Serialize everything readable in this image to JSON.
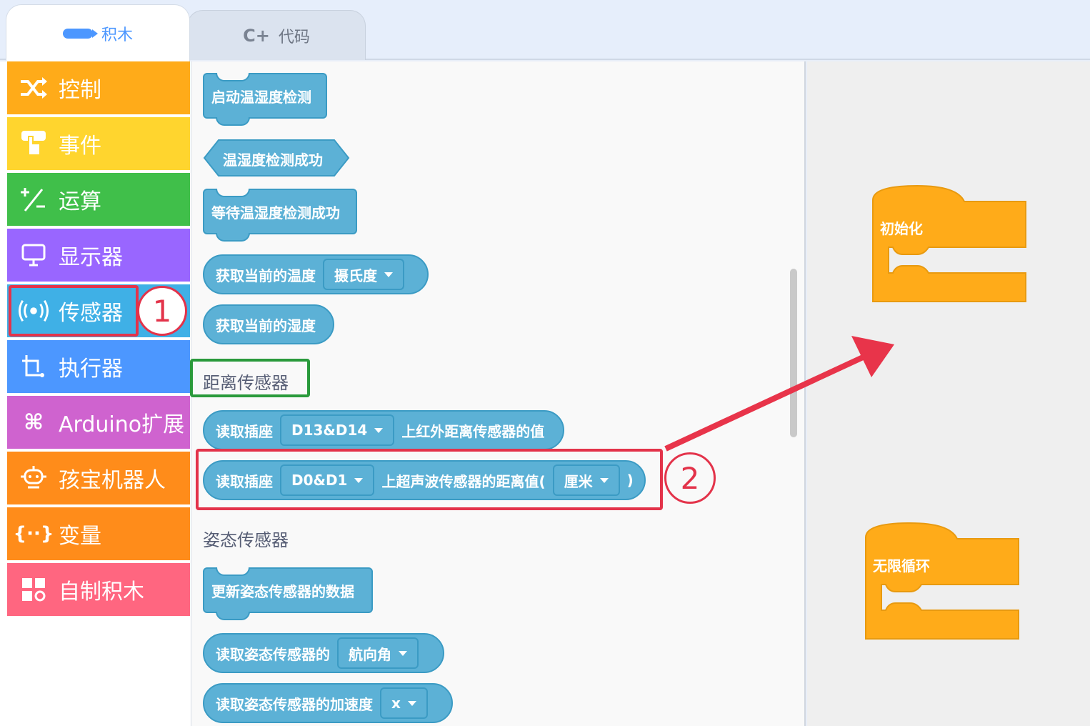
{
  "tabs": {
    "blocks": "积木",
    "code": "代码",
    "code_icon": "C+"
  },
  "categories": [
    {
      "label": "控制",
      "icon": "shuffle-icon"
    },
    {
      "label": "事件",
      "icon": "hand-icon"
    },
    {
      "label": "运算",
      "icon": "plus-minus-icon"
    },
    {
      "label": "显示器",
      "icon": "monitor-icon"
    },
    {
      "label": "传感器",
      "icon": "broadcast-icon"
    },
    {
      "label": "执行器",
      "icon": "actuator-icon"
    },
    {
      "label": "Arduino扩展",
      "icon": "command-icon"
    },
    {
      "label": "孩宝机器人",
      "icon": "robot-icon"
    },
    {
      "label": "变量",
      "icon": "braces-icon"
    },
    {
      "label": "自制积木",
      "icon": "grid-gear-icon"
    }
  ],
  "palette": {
    "blocks_humidity": {
      "start": "启动温湿度检测",
      "success": "温湿度检测成功",
      "wait": "等待温湿度检测成功",
      "get_temp": "获取当前的温度",
      "temp_unit": "摄氏度",
      "get_humidity": "获取当前的湿度"
    },
    "section_distance": "距离传感器",
    "ir_block": {
      "prefix": "读取插座",
      "port": "D13&D14",
      "suffix": "上红外距离传感器的值"
    },
    "ultrasonic_block": {
      "prefix": "读取插座",
      "port": "D0&D1",
      "middle": "上超声波传感器的距离值(",
      "unit": "厘米",
      "suffix": ")"
    },
    "section_attitude": "姿态传感器",
    "attitude": {
      "update": "更新姿态传感器的数据",
      "read_prefix": "读取姿态传感器的",
      "read_option": "航向角",
      "accel_prefix": "读取姿态传感器的加速度",
      "accel_option": "x"
    }
  },
  "workspace": {
    "init_label": "初始化",
    "loop_label": "无限循环"
  },
  "annotations": {
    "step1": "1",
    "step2": "2"
  },
  "colors": {
    "highlight_red": "#e3334a",
    "highlight_green": "#2a9a3c",
    "sensor_block": "#5cb1d6",
    "hat_block": "#ffab19"
  }
}
